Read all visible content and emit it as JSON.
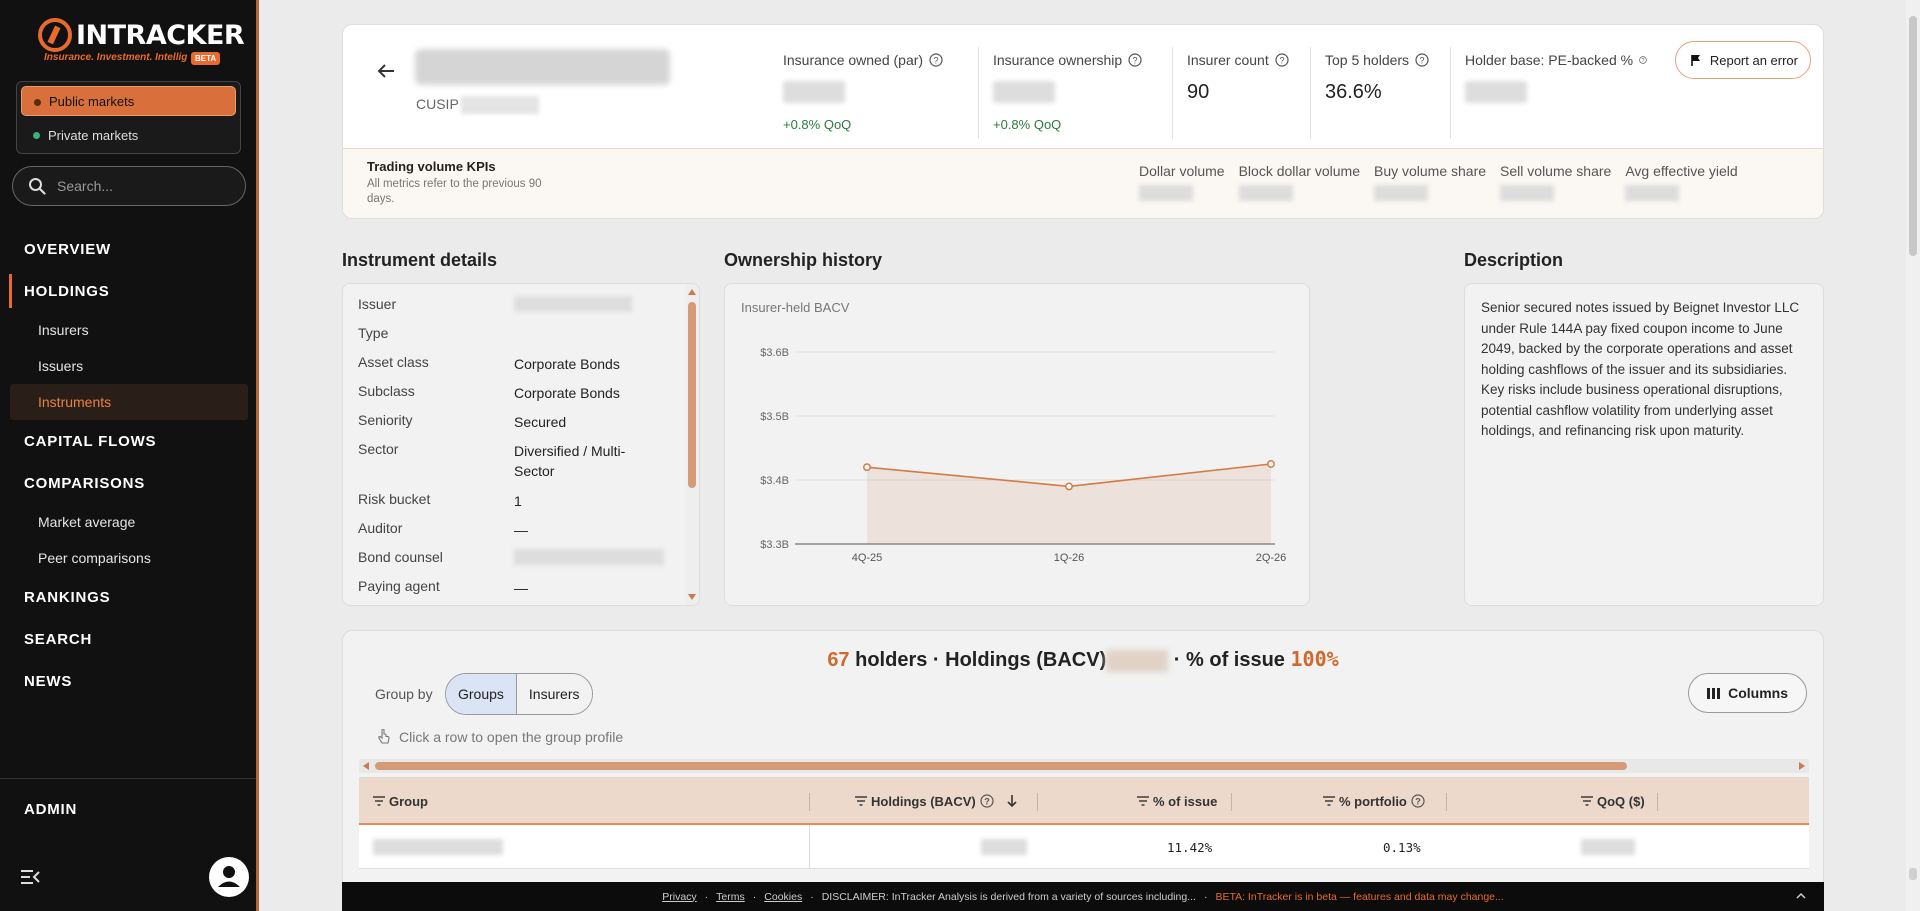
{
  "app": {
    "name": "INTRACKER",
    "tagline": "Insurance. Investment. Intellig",
    "badge": "BETA",
    "accent": "#e86a2c"
  },
  "sidebar": {
    "markets": [
      {
        "label": "Public markets",
        "active": true
      },
      {
        "label": "Private markets",
        "active": false
      }
    ],
    "search_placeholder": "Search...",
    "nav": [
      {
        "label": "OVERVIEW"
      },
      {
        "label": "HOLDINGS",
        "active": true,
        "children": [
          {
            "label": "Insurers"
          },
          {
            "label": "Issuers"
          },
          {
            "label": "Instruments",
            "active": true
          }
        ]
      },
      {
        "label": "CAPITAL FLOWS"
      },
      {
        "label": "COMPARISONS",
        "children": [
          {
            "label": "Market average"
          },
          {
            "label": "Peer comparisons"
          }
        ]
      },
      {
        "label": "RANKINGS"
      },
      {
        "label": "SEARCH"
      },
      {
        "label": "NEWS"
      }
    ],
    "admin_label": "ADMIN",
    "collapse_icon": "collapse-menu-icon",
    "avatar_icon": "user-icon"
  },
  "header": {
    "cusip_label": "CUSIP",
    "kpis": [
      {
        "label": "Insurance owned (par)",
        "value": null,
        "delta": "+0.8% QoQ"
      },
      {
        "label": "Insurance ownership",
        "value": null,
        "delta": "+0.8% QoQ"
      },
      {
        "label": "Insurer count",
        "value": "90",
        "delta": ""
      },
      {
        "label": "Top 5 holders",
        "value": "36.6%",
        "delta": ""
      },
      {
        "label": "Holder base: PE-backed %",
        "value": null,
        "delta": ""
      }
    ],
    "report_label": "Report an error",
    "trading": {
      "title": "Trading volume KPIs",
      "subtitle": "All metrics refer to the previous 90 days.",
      "metrics": [
        "Dollar volume",
        "Block dollar volume",
        "Buy volume share",
        "Sell volume share",
        "Avg effective yield"
      ]
    }
  },
  "details": {
    "title": "Instrument details",
    "rows": [
      {
        "label": "Issuer",
        "value": null
      },
      {
        "label": "Type",
        "value": ""
      },
      {
        "label": "Asset class",
        "value": "Corporate Bonds"
      },
      {
        "label": "Subclass",
        "value": "Corporate Bonds"
      },
      {
        "label": "Seniority",
        "value": "Secured"
      },
      {
        "label": "Sector",
        "value": "Diversified / Multi-Sector"
      },
      {
        "label": "Risk bucket",
        "value": "1"
      },
      {
        "label": "Auditor",
        "value": "—"
      },
      {
        "label": "Bond counsel",
        "value": null
      },
      {
        "label": "Paying agent",
        "value": "—"
      }
    ]
  },
  "history": {
    "title": "Ownership history",
    "subtitle": "Insurer-held BACV"
  },
  "chart_data": {
    "type": "area",
    "categories": [
      "4Q-25",
      "1Q-26",
      "2Q-26"
    ],
    "values": [
      3.42,
      3.39,
      3.425
    ],
    "y_ticks": [
      "$3.3B",
      "$3.4B",
      "$3.5B",
      "$3.6B"
    ],
    "ylim": [
      3.3,
      3.6
    ],
    "grid": true,
    "color": "#d47a45"
  },
  "description": {
    "title": "Description",
    "text": "Senior secured notes issued by Beignet Investor LLC under Rule 144A pay fixed coupon income to June 2049, backed by the corporate operations and asset holding cashflows of the issuer and its subsidiaries. Key risks include business operational disruptions, potential cashflow volatility from underlying asset holdings, and refinancing risk upon maturity."
  },
  "holders": {
    "count": "67",
    "count_suffix": "holders · Holdings (BACV)",
    "pct_label": "· % of issue",
    "pct_value": "100%",
    "group_by_label": "Group by",
    "group_options": [
      {
        "label": "Groups",
        "active": true
      },
      {
        "label": "Insurers",
        "active": false
      }
    ],
    "columns_label": "Columns",
    "hint": "Click a row to open the group profile",
    "table": {
      "headers": [
        "Group",
        "Holdings (BACV)",
        "% of issue",
        "% portfolio",
        "QoQ ($)"
      ],
      "rows": [
        {
          "group": null,
          "holdings": null,
          "pct_issue": "11.42%",
          "pct_portfolio": "0.13%",
          "qoq": null
        }
      ]
    }
  },
  "footer": {
    "links": [
      "Privacy",
      "Terms",
      "Cookies"
    ],
    "disclaimer": "DISCLAIMER: InTracker Analysis is derived from a variety of sources including...",
    "beta_note": "BETA: InTracker is in beta — features and data may change..."
  }
}
